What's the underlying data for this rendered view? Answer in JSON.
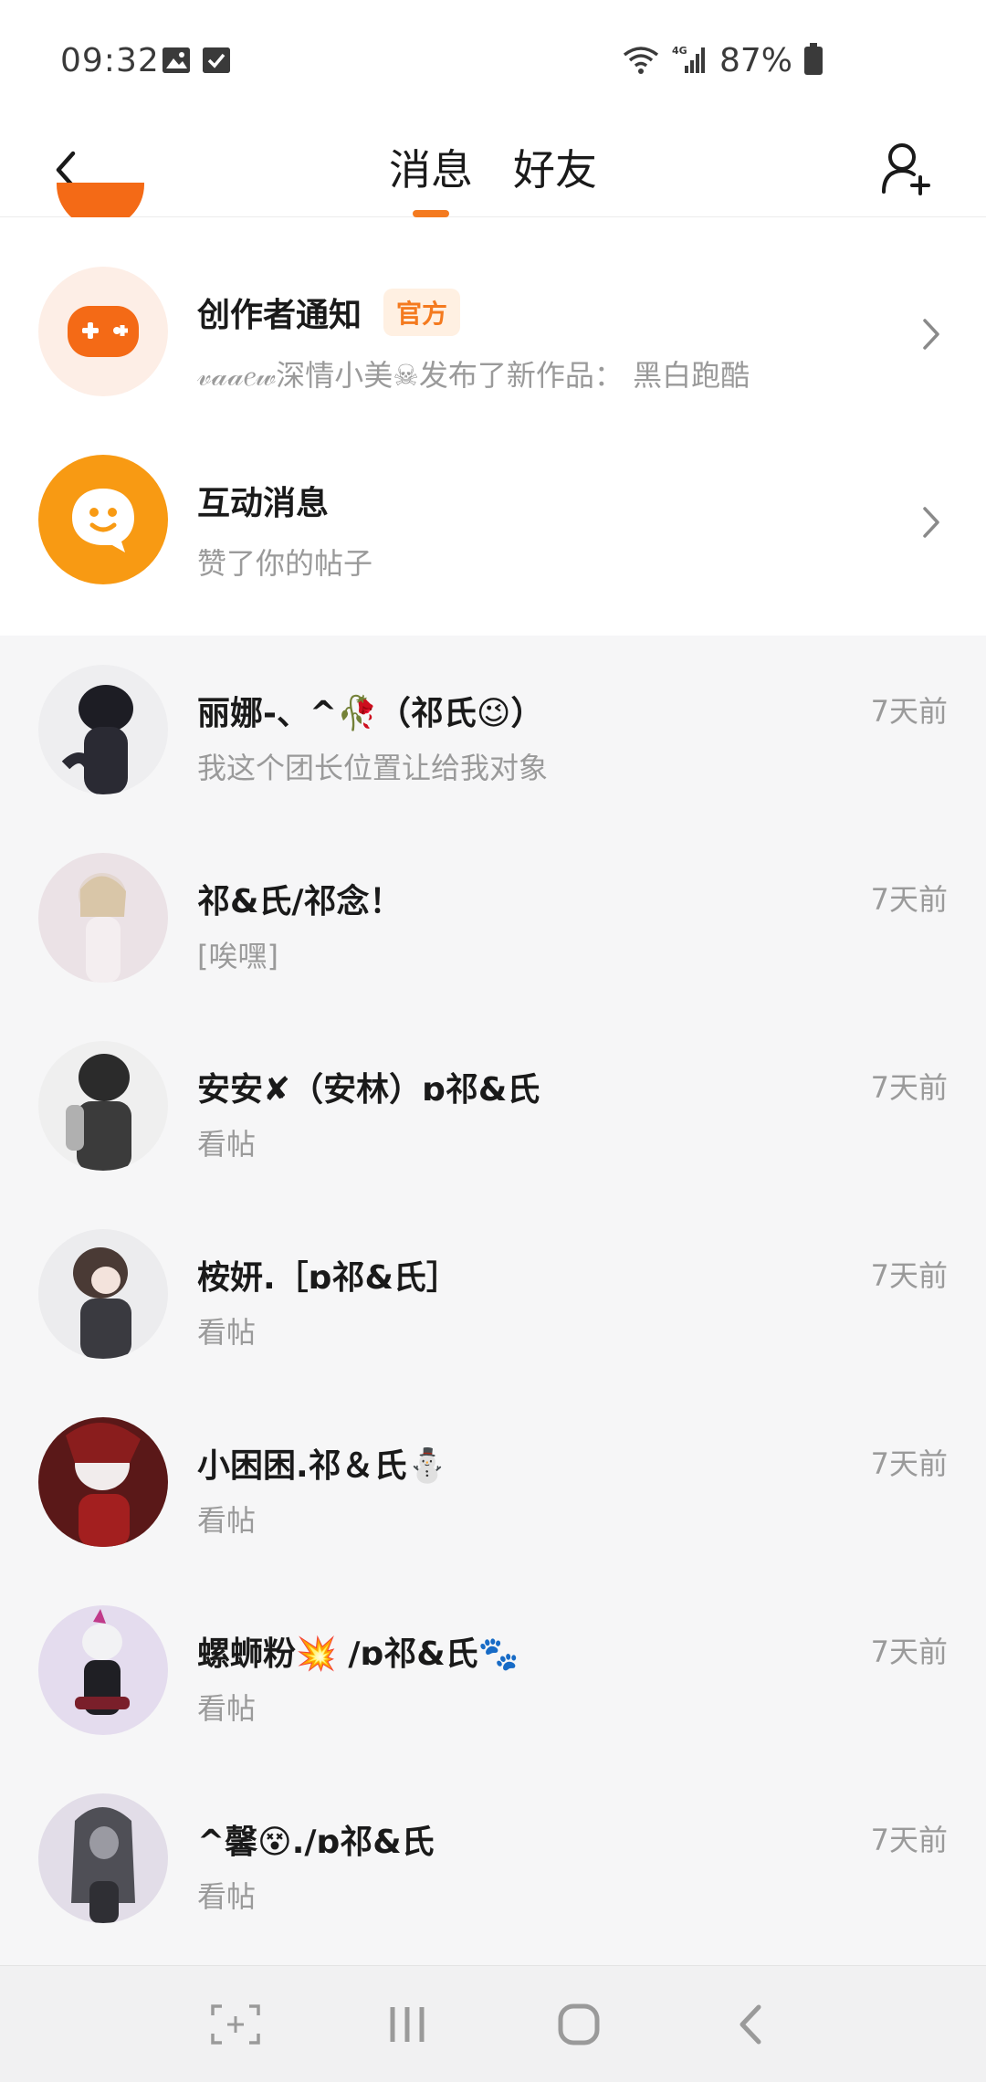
{
  "status_bar": {
    "time": "09:32",
    "battery": "87%"
  },
  "header": {
    "tabs": [
      {
        "label": "消息",
        "active": true
      },
      {
        "label": "好友",
        "active": false
      }
    ]
  },
  "system_items": [
    {
      "title": "创作者通知",
      "badge": "官方",
      "subtitle": "𝓋𝒶𝒶𝑒𝓌深情小美☠发布了新作品：  黑白跑酷",
      "icon": "gamepad-icon",
      "color": "#f46a16"
    },
    {
      "title": "互动消息",
      "subtitle": "赞了你的帖子",
      "icon": "smile-bubble-icon",
      "color": "#f89a13"
    }
  ],
  "chats": [
    {
      "name": "丽娜-、^🥀（祁氏😉）",
      "message": "我这个团长位置让给我对象",
      "time": "7天前",
      "avatar_color": "#2a2a33"
    },
    {
      "name": "祁&氏/祁念！",
      "message": "[唉嘿]",
      "time": "7天前",
      "avatar_color": "#e3d6cf"
    },
    {
      "name": "安安✘（安林）ɒ祁&氏",
      "message": "看帖",
      "time": "7天前",
      "avatar_color": "#3b3b3b"
    },
    {
      "name": "桉妍.［ɒ祁&氏］",
      "message": "看帖",
      "time": "7天前",
      "avatar_color": "#4a3a35"
    },
    {
      "name": "小困困.祁＆氏⛄",
      "message": "看帖",
      "time": "7天前",
      "avatar_color": "#7a1f1f"
    },
    {
      "name": "螺蛳粉💥 /ɒ祁&氏🐾",
      "message": "看帖",
      "time": "7天前",
      "avatar_color": "#d8d0e6"
    },
    {
      "name": "^馨😵./ɒ祁&氏",
      "message": "看帖",
      "time": "7天前",
      "avatar_color": "#5a5a60"
    }
  ]
}
